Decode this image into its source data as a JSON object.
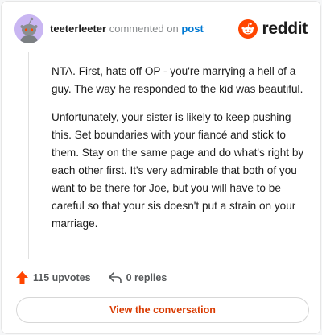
{
  "header": {
    "username": "teeterleeter",
    "verb": "commented on",
    "post_link": "post",
    "brand": "reddit",
    "avatar_color": "#c9b6f2"
  },
  "comment": {
    "paragraph_1": "NTA. First, hats off OP - you're marrying a hell of a guy. The way he responded to the kid was beautiful.",
    "paragraph_2": "Unfortunately, your sister is likely to keep pushing this. Set boundaries with your fiancé and stick to them. Stay on the same page and do what's right by each other first. It's very admirable that both of you want to be there for Joe, but you will have to be careful so that your sis doesn't put a strain on your marriage."
  },
  "actions": {
    "upvotes": "115 upvotes",
    "replies": "0 replies",
    "upvote_icon": "upvote-arrow-icon",
    "reply_icon": "reply-arrow-icon",
    "accent": "#ff4500"
  },
  "cta": {
    "label": "View the conversation",
    "color": "#d93a00"
  }
}
